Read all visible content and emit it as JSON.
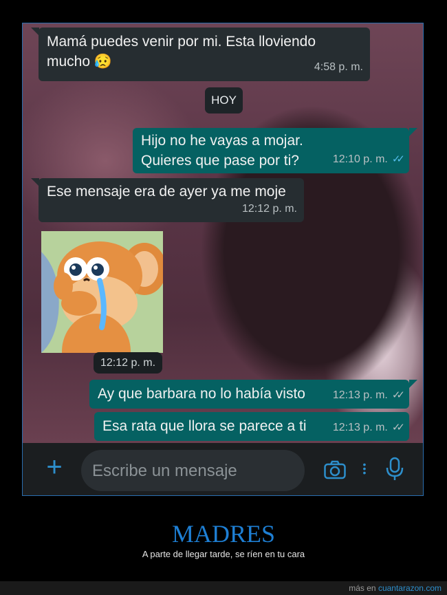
{
  "messages": [
    {
      "text_line1": "Mamá puedes venir por mi. Esta lloviendo",
      "text_line2": "mucho",
      "emoji": "😥",
      "time": "4:58 p. m."
    },
    {
      "date_label": "HOY"
    },
    {
      "text_line1": "Hijo no he vayas a mojar.",
      "text_line2": "Quieres que pase por ti?",
      "time": "12:10 p. m.",
      "ticks": "✓✓"
    },
    {
      "text": "Ese mensaje era de ayer ya me moje",
      "time": "12:12 p. m."
    },
    {
      "sticker": "crying-jerry-mouse",
      "time": "12:12 p. m."
    },
    {
      "text": "Ay que barbara no lo había visto",
      "time": "12:13 p. m.",
      "ticks": "✓✓"
    },
    {
      "text": "Esa rata que llora se parece a ti",
      "time": "12:13 p. m.",
      "ticks": "✓✓"
    }
  ],
  "composer": {
    "placeholder": "Escribe un mensaje"
  },
  "caption": {
    "title": "MADRES",
    "subtitle": "A parte de llegar tarde, se ríen en tu cara"
  },
  "footer": {
    "prefix": "más en ",
    "link": "cuantarazon.com"
  },
  "colors": {
    "incoming": "#262d31",
    "outgoing": "#056162",
    "read_tick": "#53bdeb",
    "accent": "#1e7fd4"
  }
}
